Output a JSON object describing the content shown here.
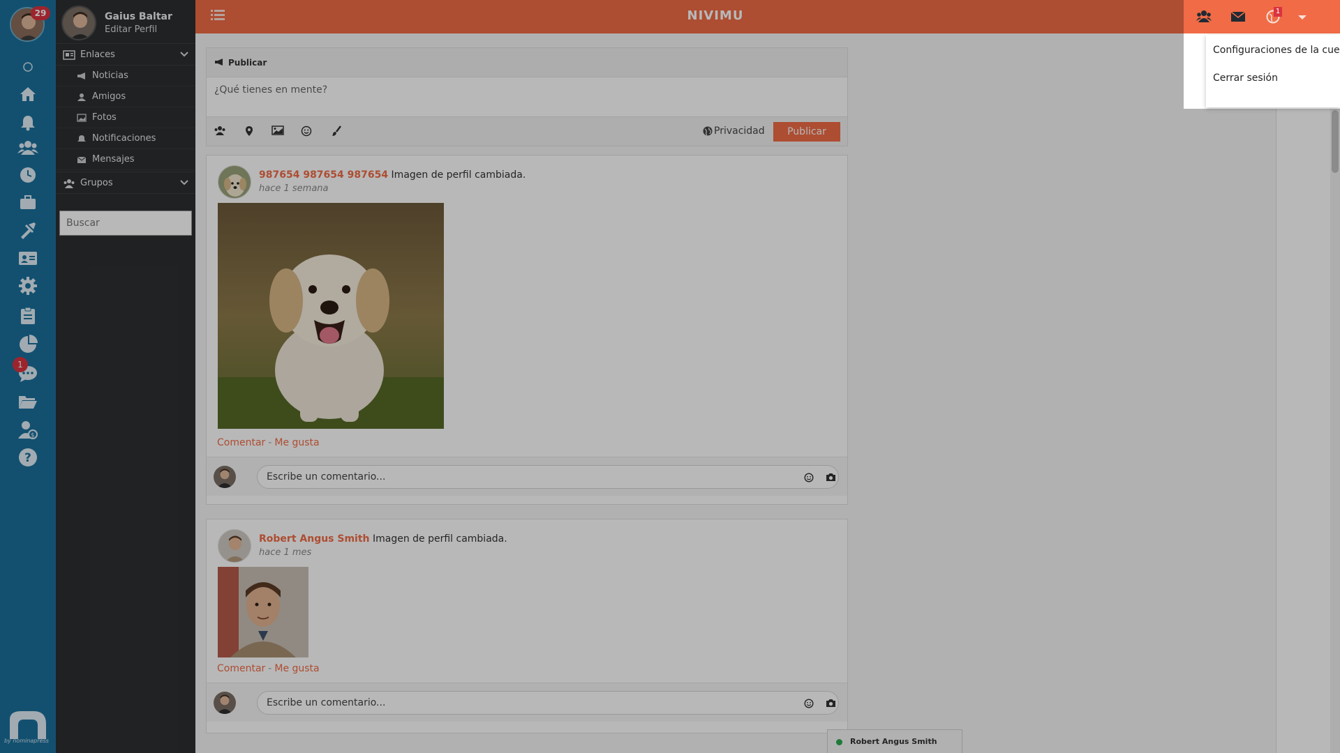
{
  "app": {
    "brand": "NIVIMU",
    "rail_badge_count": "29",
    "rail_chat_badge": "1",
    "rail_brand": "by nominapress"
  },
  "sidebar": {
    "user_name": "Gaius Baltar",
    "edit_profile": "Editar Perfil",
    "links_section": "Enlaces",
    "items": [
      {
        "label": "Noticias",
        "icon": "bullhorn-icon"
      },
      {
        "label": "Amigos",
        "icon": "users-icon"
      },
      {
        "label": "Fotos",
        "icon": "image-icon"
      },
      {
        "label": "Notificaciones",
        "icon": "bell-icon"
      },
      {
        "label": "Mensajes",
        "icon": "envelope-icon"
      }
    ],
    "groups_section": "Grupos",
    "search_placeholder": "Buscar"
  },
  "topbar": {
    "notifications_badge": "1",
    "dropdown": {
      "items": [
        "Configuraciones de la cue",
        "Cerrar sesión"
      ]
    }
  },
  "composer": {
    "title": "Publicar",
    "placeholder": "¿Qué tienes en mente?",
    "privacy_label": "Privacidad",
    "publish_label": "Publicar"
  },
  "posts": [
    {
      "author": "987654 987654 987654",
      "action": "Imagen de perfil cambiada.",
      "time": "hace 1 semana",
      "comment_label": "Comentar",
      "like_label": "Me gusta",
      "comment_placeholder": "Escribe un comentario..."
    },
    {
      "author": "Robert Angus Smith",
      "action": "Imagen de perfil cambiada.",
      "time": "hace 1 mes",
      "comment_label": "Comentar",
      "like_label": "Me gusta",
      "comment_placeholder": "Escribe un comentario..."
    }
  ],
  "chat": {
    "contact_name": "Robert Angus Smith",
    "status_color": "#2fa84f"
  },
  "colors": {
    "accent": "#f06b46",
    "rail": "#1b6f9c",
    "sidebar": "#2c2f31"
  }
}
